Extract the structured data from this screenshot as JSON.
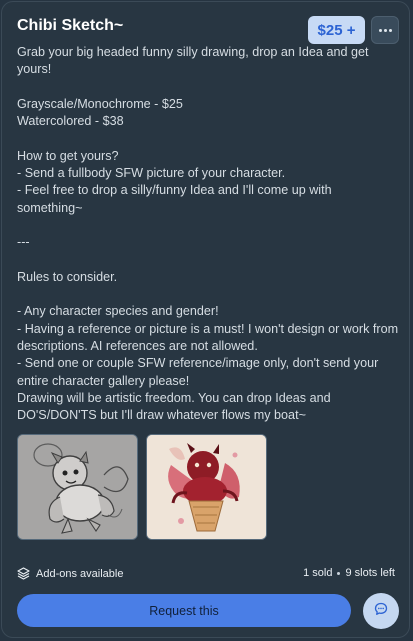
{
  "listing": {
    "title": "Chibi Sketch~",
    "price_label": "$25 +",
    "more_icon": "more-options-icon",
    "description": "Grab your big headed funny silly drawing, drop an Idea and get yours!\n\nGrayscale/Monochrome - $25\nWatercolored - $38\n\nHow to get yours?\n- Send a fullbody SFW picture of your character.\n- Feel free to drop a silly/funny Idea and I'll come up with something~\n\n---\n\nRules to consider.\n\n- Any character species and gender!\n- Having a reference or picture is a must! I won't design or work from descriptions. AI references are not allowed.\n- Send one or couple SFW reference/image only, don't send your entire character gallery please!\nDrawing will be artistic freedom. You can drop Ideas and DO'S/DON'TS but I'll draw whatever flows my boat~"
  },
  "footer": {
    "addons_icon": "layers-icon",
    "addons_label": "Add-ons available",
    "sold": "1 sold",
    "slots": "9 slots left",
    "request_label": "Request this",
    "chat_icon": "chat-bubble-icon"
  },
  "colors": {
    "background": "#283642",
    "accent": "#4a7ee6",
    "price_bg": "#c7daf5"
  }
}
